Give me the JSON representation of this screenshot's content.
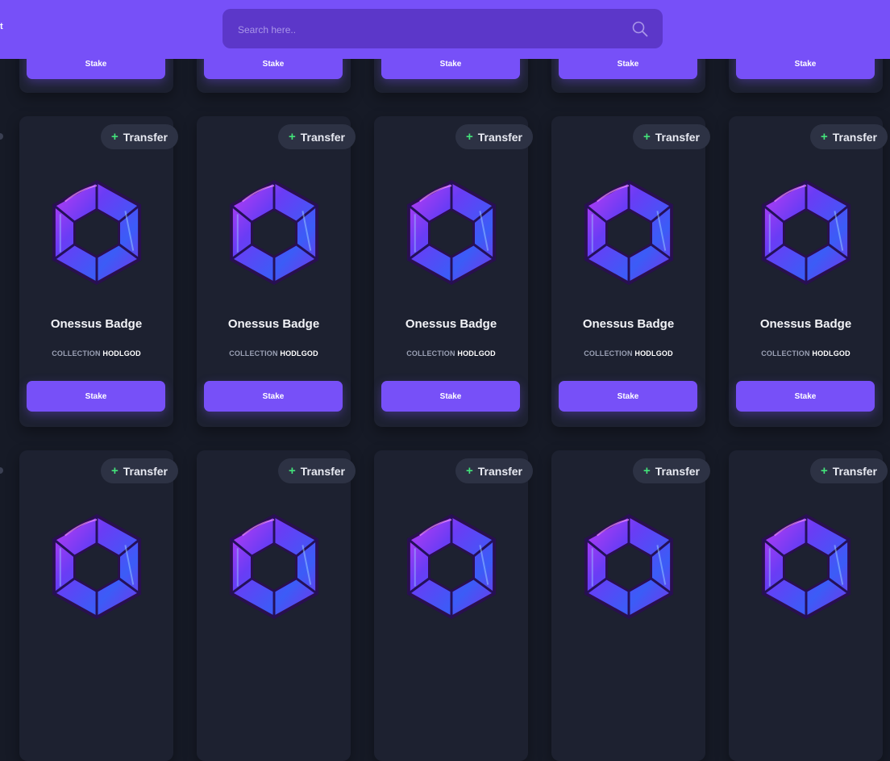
{
  "topbar": {
    "cropped_text": "t"
  },
  "search": {
    "placeholder": "Search here.."
  },
  "card": {
    "transfer_label": "Transfer",
    "title": "Onessus Badge",
    "collection_label": "COLLECTION",
    "collection_name": "HODLGOD",
    "stake_label": "Stake"
  },
  "colors": {
    "accent": "#7750f8",
    "background": "#161a26",
    "card": "#1d2130",
    "plus": "#43e37a"
  }
}
